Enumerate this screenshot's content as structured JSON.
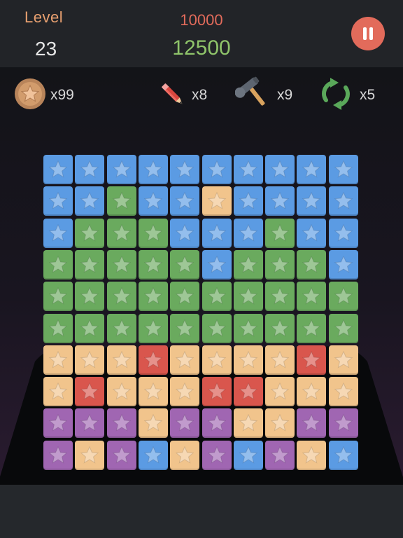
{
  "header": {
    "level_label": "Level",
    "level_value": "23",
    "target_score": "10000",
    "current_score": "12500",
    "pause_icon": "pause-icon"
  },
  "powerups": [
    {
      "name": "coin",
      "icon": "coin-star-icon",
      "count": "x99"
    },
    {
      "name": "pencil",
      "icon": "pencil-icon",
      "count": "x8"
    },
    {
      "name": "hammer",
      "icon": "hammer-icon",
      "count": "x9"
    },
    {
      "name": "shuffle",
      "icon": "refresh-arrows-icon",
      "count": "x5"
    }
  ],
  "colors": {
    "B": "#5b9be3",
    "G": "#6aaa5e",
    "Y": "#f1c48c",
    "R": "#d9564d",
    "P": "#a066b2"
  },
  "grid": [
    [
      "B",
      "B",
      "B",
      "B",
      "B",
      "B",
      "B",
      "B",
      "B",
      "B"
    ],
    [
      "B",
      "B",
      "G",
      "B",
      "B",
      "Y",
      "B",
      "B",
      "B",
      "B"
    ],
    [
      "B",
      "G",
      "G",
      "G",
      "B",
      "B",
      "B",
      "G",
      "B",
      "B"
    ],
    [
      "G",
      "G",
      "G",
      "G",
      "G",
      "B",
      "G",
      "G",
      "G",
      "B"
    ],
    [
      "G",
      "G",
      "G",
      "G",
      "G",
      "G",
      "G",
      "G",
      "G",
      "G"
    ],
    [
      "G",
      "G",
      "G",
      "G",
      "G",
      "G",
      "G",
      "G",
      "G",
      "G"
    ],
    [
      "Y",
      "Y",
      "Y",
      "R",
      "Y",
      "Y",
      "Y",
      "Y",
      "R",
      "Y"
    ],
    [
      "Y",
      "R",
      "Y",
      "Y",
      "Y",
      "R",
      "R",
      "Y",
      "Y",
      "Y"
    ],
    [
      "P",
      "P",
      "P",
      "Y",
      "P",
      "P",
      "Y",
      "Y",
      "P",
      "P"
    ],
    [
      "P",
      "Y",
      "P",
      "B",
      "Y",
      "P",
      "B",
      "P",
      "Y",
      "B"
    ]
  ]
}
